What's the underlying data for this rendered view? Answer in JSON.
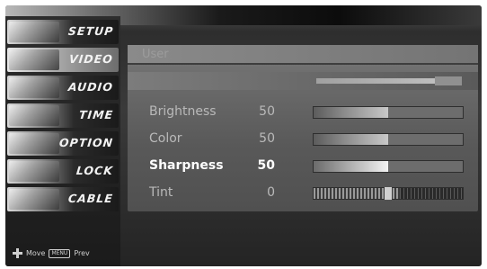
{
  "sidebar": {
    "items": [
      {
        "label": "SETUP",
        "icon": "setup-icon",
        "active": false
      },
      {
        "label": "VIDEO",
        "icon": "video-icon",
        "active": true
      },
      {
        "label": "AUDIO",
        "icon": "audio-icon",
        "active": false
      },
      {
        "label": "TIME",
        "icon": "time-icon",
        "active": false
      },
      {
        "label": "OPTION",
        "icon": "option-icon",
        "active": false
      },
      {
        "label": "LOCK",
        "icon": "lock-icon",
        "active": false
      },
      {
        "label": "CABLE",
        "icon": "cable-icon",
        "active": false
      }
    ],
    "footer": {
      "move_label": "Move",
      "menu_key": "MENU",
      "prev_label": "Prev"
    }
  },
  "main": {
    "mode_label": "User",
    "settings": [
      {
        "name": "Brightness",
        "value": "50",
        "level": 0.5
      },
      {
        "name": "Color",
        "value": "50",
        "level": 0.5
      },
      {
        "name": "Sharpness",
        "value": "50",
        "level": 0.5,
        "selected": true
      },
      {
        "name": "Tint",
        "value": "0",
        "level": 0.5
      }
    ]
  },
  "colors": {
    "background": "#2e2e2e",
    "panel": "#6c6c6c",
    "text": "#b9b9b9",
    "selected_text": "#ffffff"
  }
}
